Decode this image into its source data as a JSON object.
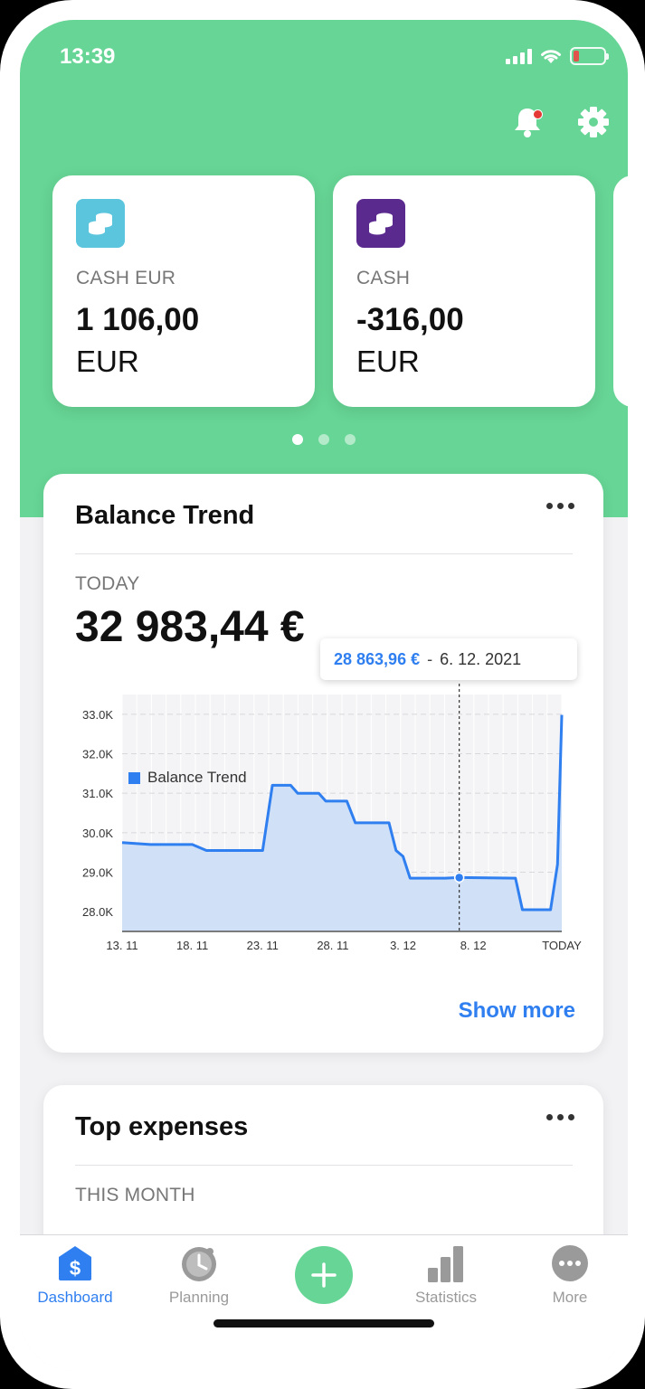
{
  "status": {
    "time": "13:39"
  },
  "accounts": [
    {
      "name": "CASH EUR",
      "amount": "1 106,00",
      "currency": "EUR",
      "color": "#5bc5dd",
      "icon": "coins-icon"
    },
    {
      "name": "CASH",
      "amount": "-316,00",
      "currency": "EUR",
      "color": "#5b2a8f",
      "icon": "coins-icon"
    }
  ],
  "pager": {
    "count": 3,
    "active": 0
  },
  "balance_trend": {
    "title": "Balance Trend",
    "period": "TODAY",
    "value": "32 983,44 €",
    "tooltip": {
      "value": "28 863,96 €",
      "sep": "-",
      "date": "6. 12. 2021"
    },
    "legend": "Balance Trend",
    "show_more": "Show more"
  },
  "chart_data": {
    "type": "area",
    "series": [
      {
        "name": "Balance Trend",
        "color": "#2f7ff0"
      }
    ],
    "x_ticks": [
      "13. 11",
      "18. 11",
      "23. 11",
      "28. 11",
      "3. 12",
      "8. 12",
      "TODAY"
    ],
    "y_ticks": [
      "33.0K",
      "32.0K",
      "31.0K",
      "30.0K",
      "29.0K",
      "28.0K"
    ],
    "ylim": [
      27500,
      33500
    ],
    "points": [
      [
        0,
        29750
      ],
      [
        2,
        29700
      ],
      [
        5,
        29700
      ],
      [
        6,
        29550
      ],
      [
        10,
        29550
      ],
      [
        10.7,
        31200
      ],
      [
        12,
        31200
      ],
      [
        12.5,
        31000
      ],
      [
        14,
        31000
      ],
      [
        14.5,
        30800
      ],
      [
        16,
        30800
      ],
      [
        16.6,
        30250
      ],
      [
        19,
        30250
      ],
      [
        19.5,
        29550
      ],
      [
        20,
        29400
      ],
      [
        20.5,
        28850
      ],
      [
        23,
        28850
      ],
      [
        24,
        28864
      ],
      [
        28,
        28850
      ],
      [
        28.5,
        28050
      ],
      [
        30.5,
        28050
      ],
      [
        31,
        29200
      ],
      [
        31.3,
        32983
      ]
    ],
    "x_domain": [
      0,
      31.3
    ],
    "highlight_x": 24,
    "highlight_y": 28864,
    "grid": true
  },
  "top_expenses": {
    "title": "Top expenses",
    "period": "THIS MONTH"
  },
  "tabs": [
    {
      "label": "Dashboard",
      "active": true
    },
    {
      "label": "Planning",
      "active": false
    },
    {
      "label": "Statistics",
      "active": false
    },
    {
      "label": "More",
      "active": false
    }
  ]
}
